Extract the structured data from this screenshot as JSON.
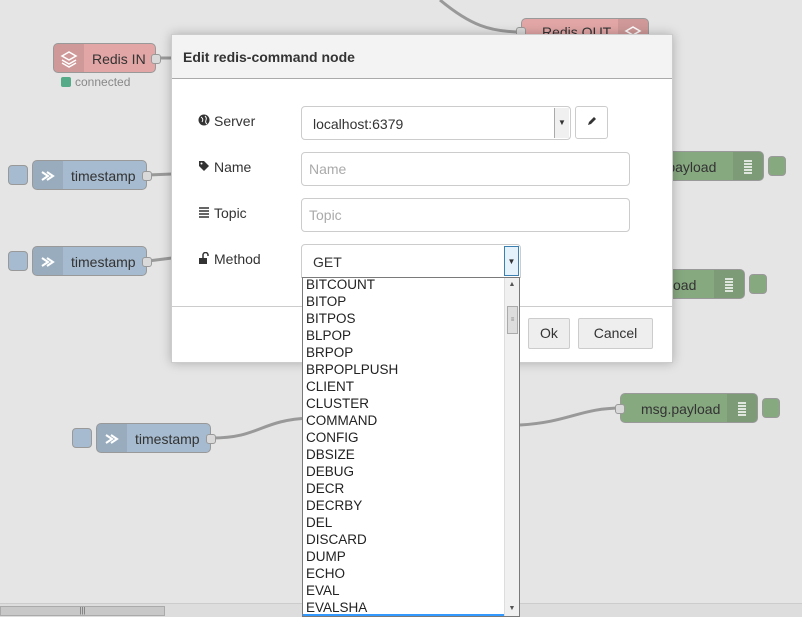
{
  "nodes": {
    "redis_in": {
      "label": "Redis IN",
      "status": "connected"
    },
    "redis_out": {
      "label": "Redis OUT"
    },
    "inject1": {
      "label": "timestamp"
    },
    "inject2": {
      "label": "timestamp"
    },
    "inject3": {
      "label": "timestamp"
    },
    "debug1": {
      "label": "msg.payload"
    },
    "debug2": {
      "label": "msg.payload"
    },
    "debug3": {
      "label": "msg.payload"
    }
  },
  "dialog": {
    "title": "Edit redis-command node",
    "server_label": "Server",
    "server_value": "localhost:6379",
    "name_label": "Name",
    "name_placeholder": "Name",
    "topic_label": "Topic",
    "topic_placeholder": "Topic",
    "method_label": "Method",
    "method_value": "GET",
    "ok_label": "Ok",
    "cancel_label": "Cancel"
  },
  "method_options": [
    "BITCOUNT",
    "BITOP",
    "BITPOS",
    "BLPOP",
    "BRPOP",
    "BRPOPLPUSH",
    "CLIENT",
    "CLUSTER",
    "COMMAND",
    "CONFIG",
    "DBSIZE",
    "DEBUG",
    "DECR",
    "DECRBY",
    "DEL",
    "DISCARD",
    "DUMP",
    "ECHO",
    "EVAL",
    "EVALSHA"
  ],
  "icons": {
    "server": "globe-icon",
    "name": "tag-icon",
    "topic": "list-icon",
    "method": "unlock-icon",
    "edit": "pencil-icon"
  },
  "colors": {
    "inject": "#a6bbcf",
    "redis": "#e2a6a6",
    "debug": "#87a980",
    "status_connected": "#5a8"
  }
}
